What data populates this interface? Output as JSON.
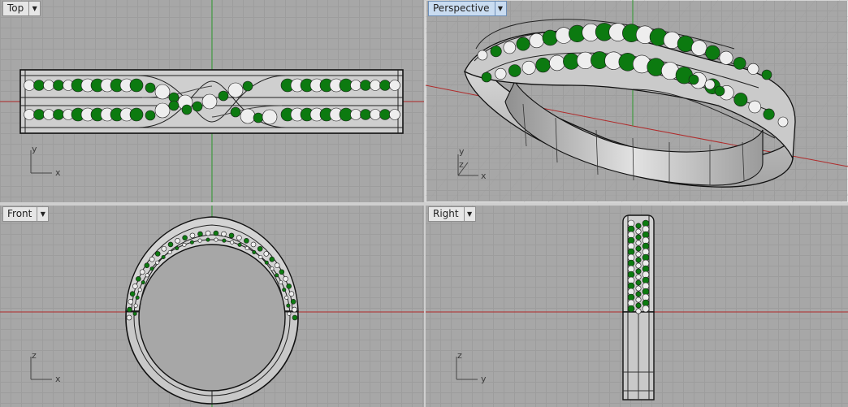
{
  "viewports": {
    "top": {
      "label": "Top"
    },
    "persp": {
      "label": "Perspective"
    },
    "front": {
      "label": "Front"
    },
    "right": {
      "label": "Right"
    }
  },
  "axis_labels": {
    "top": {
      "v": "y",
      "h": "x"
    },
    "persp": {
      "v": "y",
      "z": "z",
      "h": "x"
    },
    "front": {
      "v": "z",
      "h": "x"
    },
    "right": {
      "v": "z",
      "h": "y"
    }
  },
  "colors": {
    "grid_background": "#a7a7a7",
    "grid_line": "#9d9d9d",
    "x_axis": "#b02a2a",
    "y_axis": "#2e9a2e",
    "stone_green": "#0c7a10",
    "stone_white": "#eeeeee",
    "metal": "#c9c9c9"
  },
  "icons": {
    "dropdown": "dropdown-arrow-icon",
    "axes": "axis-triad-icon"
  }
}
